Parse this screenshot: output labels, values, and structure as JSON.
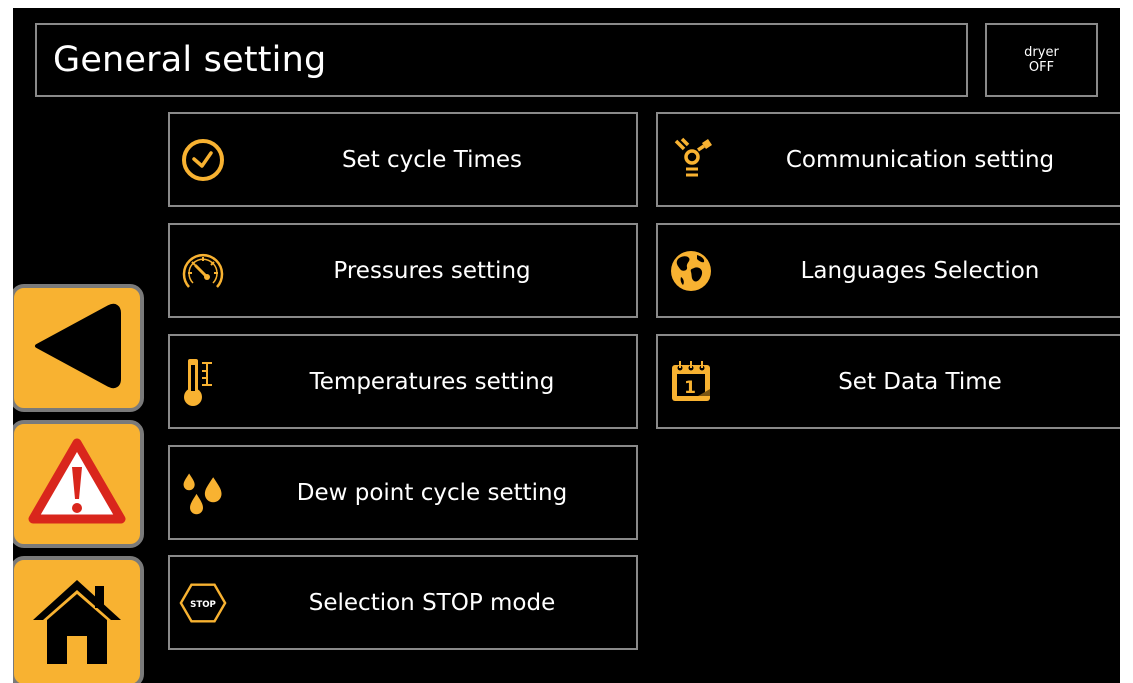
{
  "header": {
    "title": "General setting",
    "status_line1": "dryer",
    "status_line2": "OFF"
  },
  "menu": {
    "left": [
      {
        "label": "Set cycle Times",
        "icon": "clock-icon"
      },
      {
        "label": "Pressures setting",
        "icon": "gauge-icon"
      },
      {
        "label": "Temperatures setting",
        "icon": "thermometer-icon"
      },
      {
        "label": "Dew point cycle setting",
        "icon": "droplets-icon"
      },
      {
        "label": "Selection STOP mode",
        "icon": "stop-icon"
      }
    ],
    "right": [
      {
        "label": "Communication setting",
        "icon": "firewire-icon"
      },
      {
        "label": "Languages Selection",
        "icon": "globe-icon"
      },
      {
        "label": "Set Data Time",
        "icon": "calendar-icon"
      }
    ]
  },
  "icons": {
    "stop_text": "STOP",
    "calendar_day": "1"
  },
  "sidebar": {
    "back": "back-arrow-icon",
    "alarm": "warning-icon",
    "home": "home-icon"
  },
  "colors": {
    "accent": "#f8b231",
    "border": "#8a8a8a",
    "background": "#000000",
    "warning_red": "#d9261c"
  }
}
